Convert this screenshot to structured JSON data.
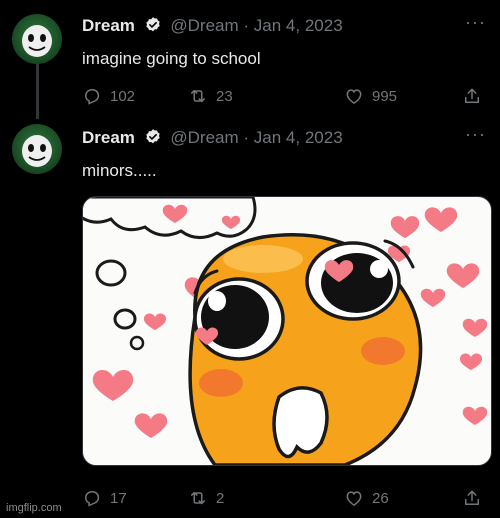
{
  "tweet1": {
    "name": "Dream",
    "handle": "@Dream",
    "separator": "·",
    "date": "Jan 4, 2023",
    "text": "imagine going to school",
    "replies": "102",
    "retweets": "23",
    "likes": "995"
  },
  "tweet2": {
    "name": "Dream",
    "handle": "@Dream",
    "separator": "·",
    "date": "Jan 4, 2023",
    "text": "minors.....",
    "replies": "17",
    "retweets": "2",
    "likes": "26"
  },
  "more_glyph": "···",
  "watermark": "imgflip.com",
  "icons": {
    "verified": "verified-badge-icon",
    "reply": "reply-icon",
    "retweet": "retweet-icon",
    "like": "heart-icon",
    "share": "share-icon"
  },
  "colors": {
    "background": "#000000",
    "text": "#e7e9ea",
    "muted": "#71767b",
    "thread_line": "#333639",
    "avatar_green": "#2f7a3c",
    "emoji_orange": "#f7a21b",
    "heart_pink": "#f47a86"
  }
}
